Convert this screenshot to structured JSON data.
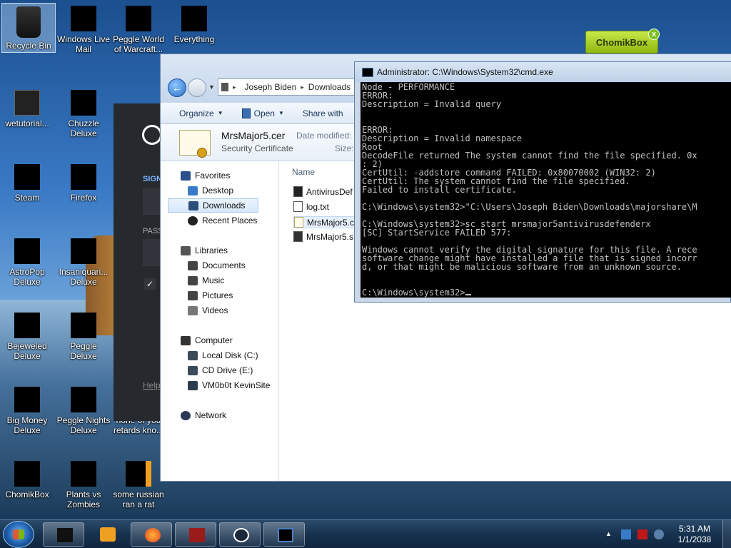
{
  "desktop": {
    "icons": [
      {
        "label": "Recycle Bin"
      },
      {
        "label": "Windows Live Mail"
      },
      {
        "label": "Peggle World of Warcraft..."
      },
      {
        "label": "Everything"
      },
      {
        "label": "wetutorial..."
      },
      {
        "label": "Chuzzle Deluxe"
      },
      {
        "label": "Steam"
      },
      {
        "label": "Firefox"
      },
      {
        "label": "AstroPop Deluxe"
      },
      {
        "label": "Insaniquari... Deluxe"
      },
      {
        "label": "Bejeweled Deluxe"
      },
      {
        "label": "Peggle Deluxe"
      },
      {
        "label": "Big Money Deluxe"
      },
      {
        "label": "Peggle Nights Deluxe"
      },
      {
        "label": "none of you retards kno..."
      },
      {
        "label": "ChomikBox"
      },
      {
        "label": "Plants vs Zombies"
      },
      {
        "label": "some russian ran a rat"
      }
    ]
  },
  "chomikbox_widget": {
    "label": "ChomikBox",
    "close": "x"
  },
  "steam_login": {
    "sign_label": "SIGN",
    "pass_label": "PASS",
    "check": "✓",
    "help": "Help"
  },
  "explorer": {
    "breadcrumb": [
      "Joseph Biden",
      "Downloads"
    ],
    "toolbar": {
      "organize": "Organize",
      "open": "Open",
      "share": "Share with"
    },
    "details": {
      "name": "MrsMajor5.cer",
      "type": "Security Certificate",
      "modified_label": "Date modified:",
      "size_label": "Size:"
    },
    "nav": {
      "favorites": "Favorites",
      "desktop": "Desktop",
      "downloads": "Downloads",
      "recent": "Recent Places",
      "libraries": "Libraries",
      "documents": "Documents",
      "music": "Music",
      "pictures": "Pictures",
      "videos": "Videos",
      "computer": "Computer",
      "local_disk": "Local Disk (C:)",
      "cd_drive": "CD Drive (E:)",
      "vm": "VM0b0t KevinSite",
      "network": "Network"
    },
    "column_name": "Name",
    "files": [
      "AntivirusDef",
      "log.txt",
      "MrsMajor5.c",
      "MrsMajor5.s"
    ]
  },
  "cmd": {
    "title": "Administrator: C:\\Windows\\System32\\cmd.exe",
    "lines": [
      "Node - PERFORMANCE",
      "ERROR:",
      "Description = Invalid query",
      "",
      "",
      "ERROR:",
      "Description = Invalid namespace",
      "Root",
      "DecodeFile returned The system cannot find the file specified. 0x",
      ": 2)",
      "CertUtil: -addstore command FAILED: 0x80070002 (WIN32: 2)",
      "CertUtil: The system cannot find the file specified.",
      "Failed to install certificate.",
      "",
      "C:\\Windows\\system32>\"C:\\Users\\Joseph Biden\\Downloads\\majorshare\\M",
      "",
      "C:\\Windows\\system32>sc start mrsmajor5antivirusdefenderx",
      "[SC] StartService FAILED 577:",
      "",
      "Windows cannot verify the digital signature for this file. A rece",
      "software change might have installed a file that is signed incorr",
      "d, or that might be malicious software from an unknown source.",
      "",
      ""
    ],
    "prompt": "C:\\Windows\\system32>"
  },
  "taskbar": {
    "clock_time": "5:31 AM",
    "clock_date": "1/1/2038"
  }
}
